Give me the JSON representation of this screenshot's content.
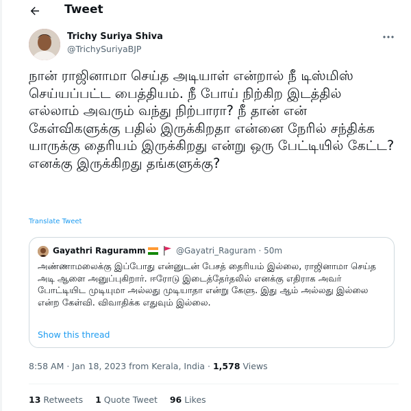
{
  "header": {
    "title": "Tweet",
    "back_icon": "arrow-left-icon"
  },
  "tweet": {
    "author_name": "Trichy Suriya Shiva",
    "author_handle": "@TrichySuriyaBJP",
    "text": "நான் ராஜினாமா செய்த அடியாள் என்றால் நீ டிஸ்மிஸ் செய்யப்பட்ட பைத்தியம். நீ போய் நிற்கிற இடத்தில் எல்லாம் அவரும் வந்து நிற்பாரா? நீ தான் என் கேள்விகளுக்கு பதில் இருக்கிறதா என்னை நேரில் சந்திக்க யாருக்கு தைரியம் இருக்கிறது என்று ஒரு பேட்டியில் கேட்ட? எனக்கு இருக்கிறது தங்களுக்கு?",
    "translate_label": "Translate Tweet",
    "more_icon": "more-horizontal-icon",
    "timestamp": "8:58 AM · Jan 18, 2023 from Kerala, India · ",
    "views_count": "1,578",
    "views_label": " Views"
  },
  "quote": {
    "author_name": "Gayathri Raguramm",
    "author_handle": "@Gayatri_Raguram",
    "time": "50m",
    "meta": "@Gayatri_Raguram · 50m",
    "text": "அண்ணாமலைக்கு இப்போது என்னுடன் பேசத் தைரியம் இல்லை, ராஜினாமா செய்த அடி ஆளை அனுப்புகிறார். ஈரோடு இடைத்தேர்தலில் எனக்கு எதிராக அவர் போட்டியிட முடியுமா அல்லது முடியாதா என்று கேளு. இது ஆம் அல்லது இல்லை என்ற கேள்வி. விவாதிக்க எதுவும் இல்லை.",
    "show_thread_label": "Show this thread",
    "flags": [
      "india-flag-icon",
      "red-flag-icon"
    ]
  },
  "stats": {
    "retweets_count": "13",
    "retweets_label": " Retweets",
    "quotes_count": "1",
    "quotes_label": " Quote Tweet",
    "likes_count": "96",
    "likes_label": " Likes"
  },
  "colors": {
    "link": "#1d9bf0",
    "secondary_text": "#536471",
    "border": "#cfd9de"
  }
}
